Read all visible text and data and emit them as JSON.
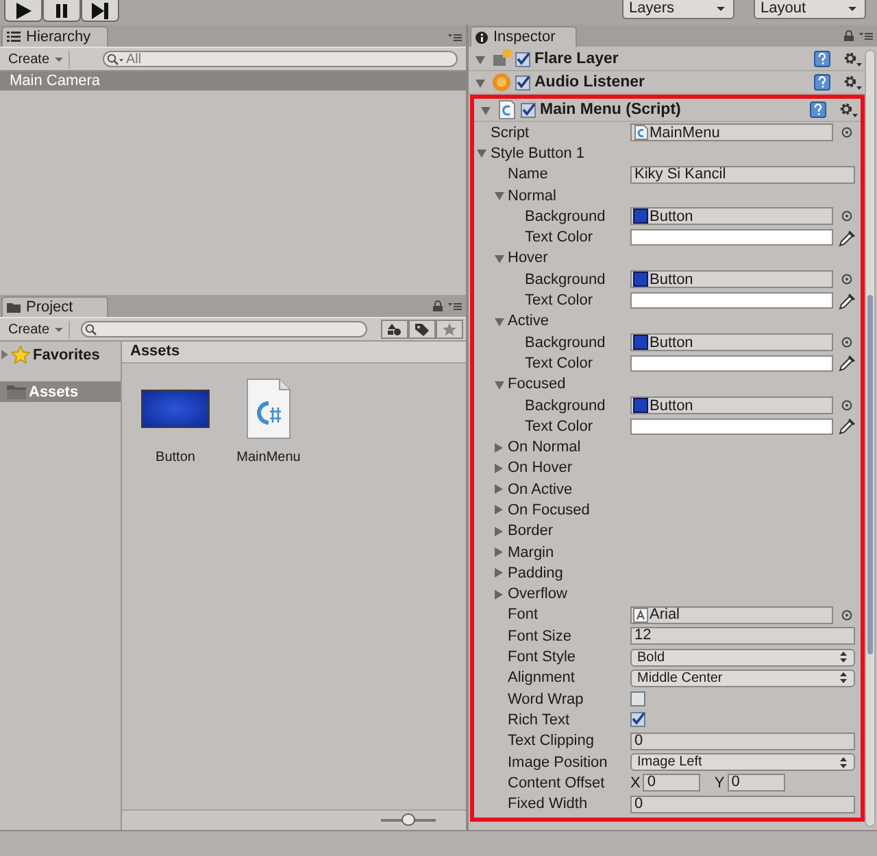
{
  "toolbar": {
    "layers_dropdown": "Layers",
    "layout_dropdown": "Layout"
  },
  "hierarchy": {
    "title": "Hierarchy",
    "create": "Create",
    "search_placeholder": "All",
    "items": [
      {
        "label": "Main Camera",
        "selected": true
      }
    ]
  },
  "project": {
    "title": "Project",
    "create": "Create",
    "tree": [
      {
        "label": "Favorites",
        "selected": false,
        "expanded": false,
        "kind": "favorites"
      },
      {
        "label": "Assets",
        "selected": true,
        "kind": "folder"
      }
    ],
    "breadcrumb": "Assets",
    "assets": [
      {
        "label": "Button",
        "kind": "texture"
      },
      {
        "label": "MainMenu",
        "kind": "script"
      }
    ],
    "zoom_slider": {
      "level": 0.5
    }
  },
  "inspector": {
    "title": "Inspector",
    "components": [
      {
        "name": "Flare Layer",
        "kind": "flare_layer",
        "enabled": true,
        "expanded": true,
        "highlighted": false
      },
      {
        "name": "Audio Listener",
        "kind": "audio_listener",
        "enabled": true,
        "expanded": true,
        "highlighted": false
      },
      {
        "name": "Main Menu (Script)",
        "kind": "script",
        "enabled": true,
        "expanded": true,
        "highlighted": true,
        "properties": [
          {
            "kind": "script_ref",
            "label": "Script",
            "value": "MainMenu"
          },
          {
            "kind": "foldout",
            "label": "Style Button 1",
            "expanded": true,
            "children": [
              {
                "kind": "text",
                "label": "Name",
                "value": "Kiky Si Kancil"
              },
              {
                "kind": "foldout",
                "label": "Normal",
                "expanded": true,
                "children": [
                  {
                    "kind": "texture_ref",
                    "label": "Background",
                    "value": "Button"
                  },
                  {
                    "kind": "color",
                    "label": "Text Color",
                    "color": "#ffffff"
                  }
                ]
              },
              {
                "kind": "foldout",
                "label": "Hover",
                "expanded": true,
                "children": [
                  {
                    "kind": "texture_ref",
                    "label": "Background",
                    "value": "Button"
                  },
                  {
                    "kind": "color",
                    "label": "Text Color",
                    "color": "#ffffff"
                  }
                ]
              },
              {
                "kind": "foldout",
                "label": "Active",
                "expanded": true,
                "children": [
                  {
                    "kind": "texture_ref",
                    "label": "Background",
                    "value": "Button"
                  },
                  {
                    "kind": "color",
                    "label": "Text Color",
                    "color": "#ffffff"
                  }
                ]
              },
              {
                "kind": "foldout",
                "label": "Focused",
                "expanded": true,
                "children": [
                  {
                    "kind": "texture_ref",
                    "label": "Background",
                    "value": "Button"
                  },
                  {
                    "kind": "color",
                    "label": "Text Color",
                    "color": "#ffffff"
                  }
                ]
              },
              {
                "kind": "foldout",
                "label": "On Normal",
                "expanded": false
              },
              {
                "kind": "foldout",
                "label": "On Hover",
                "expanded": false
              },
              {
                "kind": "foldout",
                "label": "On Active",
                "expanded": false
              },
              {
                "kind": "foldout",
                "label": "On Focused",
                "expanded": false
              },
              {
                "kind": "foldout",
                "label": "Border",
                "expanded": false
              },
              {
                "kind": "foldout",
                "label": "Margin",
                "expanded": false
              },
              {
                "kind": "foldout",
                "label": "Padding",
                "expanded": false
              },
              {
                "kind": "foldout",
                "label": "Overflow",
                "expanded": false
              },
              {
                "kind": "font_ref",
                "label": "Font",
                "value": "Arial"
              },
              {
                "kind": "text",
                "label": "Font Size",
                "value": "12"
              },
              {
                "kind": "enum",
                "label": "Font Style",
                "value": "Bold"
              },
              {
                "kind": "enum",
                "label": "Alignment",
                "value": "Middle Center"
              },
              {
                "kind": "toggle",
                "label": "Word Wrap",
                "checked": false
              },
              {
                "kind": "toggle",
                "label": "Rich Text",
                "checked": true
              },
              {
                "kind": "text",
                "label": "Text Clipping",
                "value": "0"
              },
              {
                "kind": "enum",
                "label": "Image Position",
                "value": "Image Left"
              },
              {
                "kind": "vector2",
                "label": "Content Offset",
                "fields": [
                  {
                    "axis": "X",
                    "value": "0"
                  },
                  {
                    "axis": "Y",
                    "value": "0"
                  }
                ]
              },
              {
                "kind": "text",
                "label": "Fixed Width",
                "value": "0"
              }
            ]
          }
        ]
      }
    ]
  }
}
